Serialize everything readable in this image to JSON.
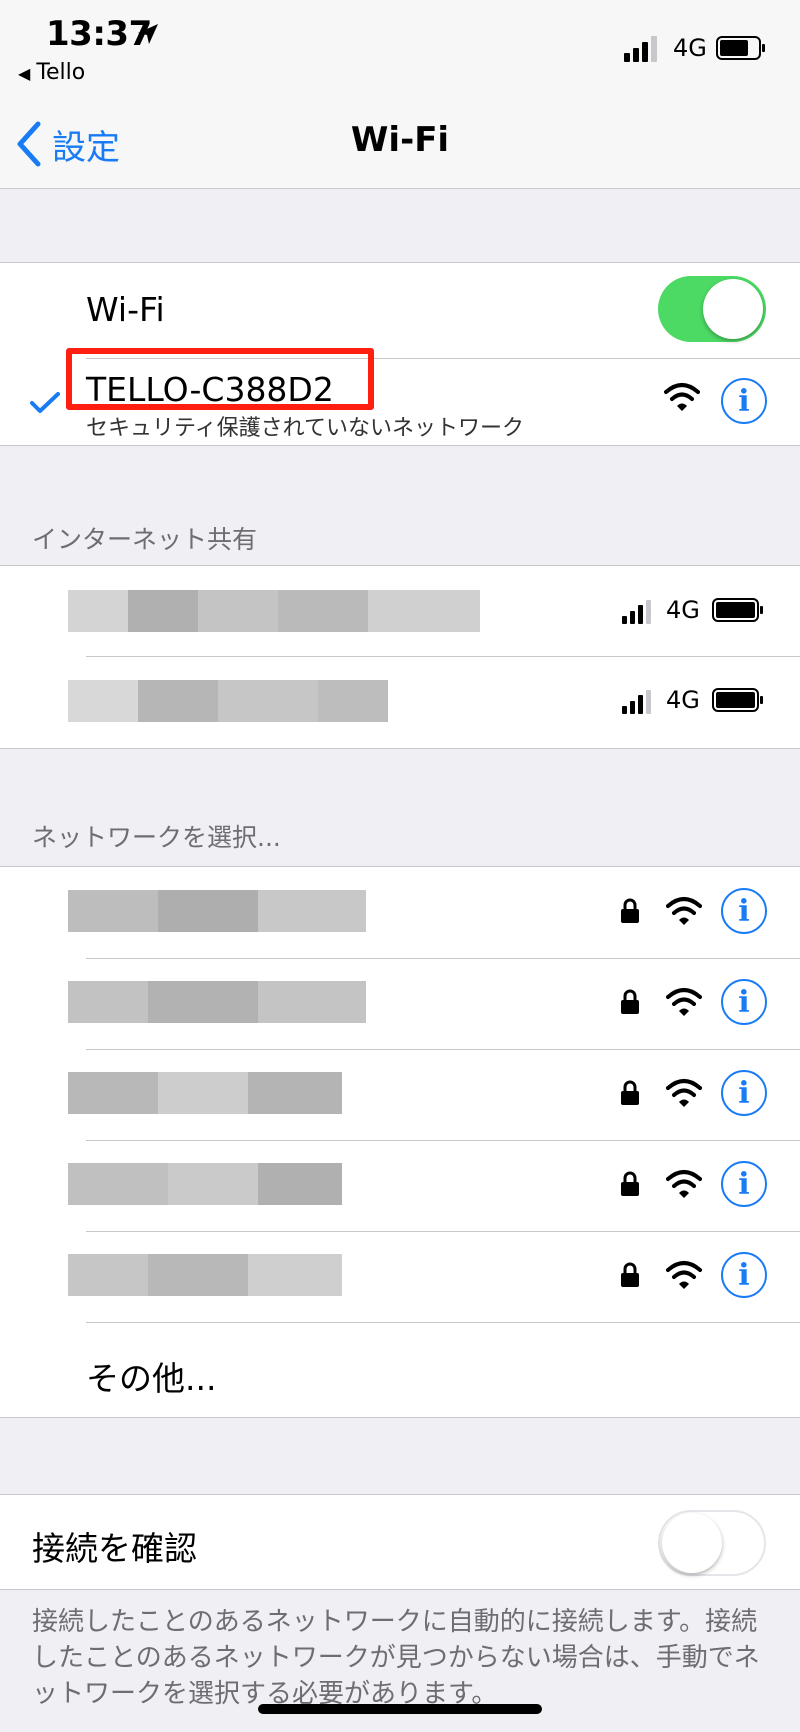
{
  "status_bar": {
    "time": "13:37",
    "back_app": "Tello",
    "network": "4G"
  },
  "nav": {
    "back_label": "設定",
    "title": "Wi-Fi"
  },
  "wifi": {
    "label": "Wi-Fi",
    "enabled": true,
    "connected_network": "TELLO-C388D2",
    "connected_subtitle": "セキュリティ保護されていないネットワーク"
  },
  "hotspot": {
    "header": "インターネット共有",
    "items": [
      {
        "network": "4G"
      },
      {
        "network": "4G"
      }
    ]
  },
  "networks": {
    "header": "ネットワークを選択...",
    "other_label": "その他..."
  },
  "ask_to_join": {
    "label": "接続を確認",
    "enabled": false,
    "description": "接続したことのあるネットワークに自動的に接続します。接続したことのあるネットワークが見つからない場合は、手動でネットワークを選択する必要があります。"
  },
  "colors": {
    "accent": "#1a7cf5",
    "toggle_on": "#4cd964",
    "highlight_box": "#ff1f10",
    "background": "#efeff4"
  },
  "icons": [
    "location-arrow-icon",
    "signal-bars-icon",
    "battery-icon",
    "chevron-left-icon",
    "checkmark-icon",
    "wifi-icon",
    "info-icon",
    "lock-icon"
  ]
}
